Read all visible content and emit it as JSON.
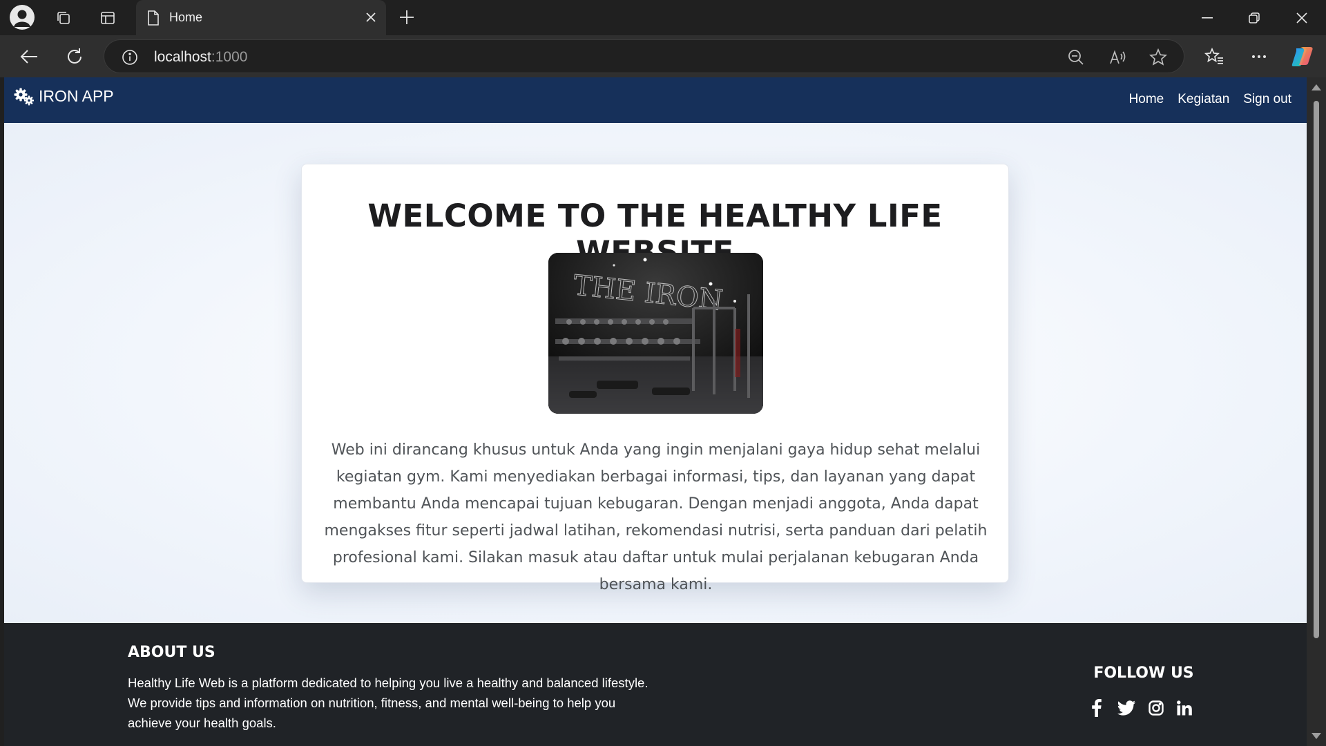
{
  "browser": {
    "tab_title": "Home",
    "url_host": "localhost",
    "url_port": ":1000"
  },
  "navbar": {
    "brand": "IRON APP",
    "brand_icon": "gears-icon",
    "links": [
      "Home",
      "Kegiatan",
      "Sign out"
    ]
  },
  "hero": {
    "title": "WELCOME TO THE HEALTHY LIFE WEBSITE",
    "image_sign_text": "THE IRON",
    "description": "Web ini dirancang khusus untuk Anda yang ingin menjalani gaya hidup sehat melalui kegiatan gym. Kami menyediakan berbagai informasi, tips, dan layanan yang dapat membantu Anda mencapai tujuan kebugaran. Dengan menjadi anggota, Anda dapat mengakses fitur seperti jadwal latihan, rekomendasi nutrisi, serta panduan dari pelatih profesional kami. Silakan masuk atau daftar untuk mulai perjalanan kebugaran Anda bersama kami."
  },
  "footer": {
    "about_title": "ABOUT US",
    "about_text": "Healthy Life Web is a platform dedicated to helping you live a healthy and balanced lifestyle. We provide tips and information on nutrition, fitness, and mental well-being to help you achieve your health goals.",
    "follow_title": "FOLLOW US",
    "socials": [
      "facebook-icon",
      "twitter-icon",
      "instagram-icon",
      "linkedin-icon"
    ]
  },
  "colors": {
    "navbar": "#16305a",
    "footer": "#202327",
    "page_bg": "#eef3fa"
  }
}
